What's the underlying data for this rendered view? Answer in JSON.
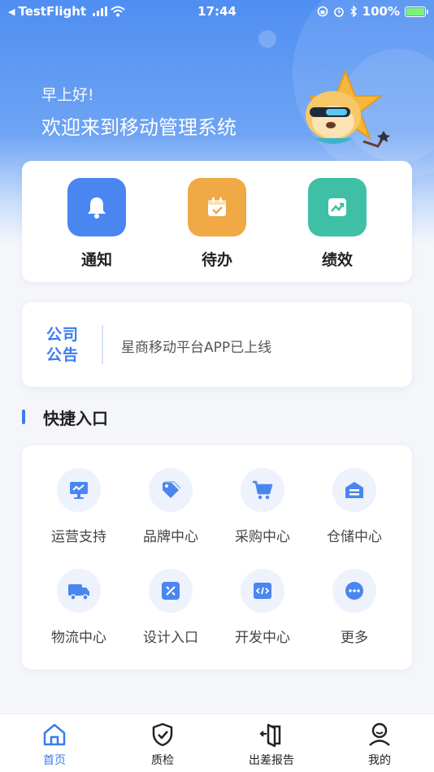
{
  "status_bar": {
    "back_app": "TestFlight",
    "time": "17:44",
    "battery": "100%",
    "battery_level": 1.0
  },
  "greeting": {
    "small": "早上好!",
    "title": "欢迎来到移动管理系统"
  },
  "quick_actions": [
    {
      "label": "通知",
      "icon": "bell-icon",
      "color": "#4a86f0"
    },
    {
      "label": "待办",
      "icon": "calendar-check-icon",
      "color": "#f0a944"
    },
    {
      "label": "绩效",
      "icon": "trend-chart-icon",
      "color": "#3fbfa5"
    }
  ],
  "notice": {
    "tag_line1": "公司",
    "tag_line2": "公告",
    "text": "星商移动平台APP已上线"
  },
  "shortcuts": {
    "title": "快捷入口",
    "items": [
      {
        "label": "运营支持",
        "icon": "monitor-chart-icon"
      },
      {
        "label": "品牌中心",
        "icon": "tag-icon"
      },
      {
        "label": "采购中心",
        "icon": "cart-icon"
      },
      {
        "label": "仓储中心",
        "icon": "warehouse-icon"
      },
      {
        "label": "物流中心",
        "icon": "truck-icon"
      },
      {
        "label": "设计入口",
        "icon": "design-tools-icon"
      },
      {
        "label": "开发中心",
        "icon": "code-icon"
      },
      {
        "label": "更多",
        "icon": "more-icon"
      }
    ]
  },
  "tabbar": {
    "items": [
      {
        "label": "首页",
        "icon": "home-icon",
        "active": true
      },
      {
        "label": "质检",
        "icon": "shield-check-icon",
        "active": false
      },
      {
        "label": "出差报告",
        "icon": "door-exit-icon",
        "active": false
      },
      {
        "label": "我的",
        "icon": "user-icon",
        "active": false
      }
    ]
  },
  "colors": {
    "accent": "#3a7bef",
    "hero_top": "#4f8ef2",
    "page_bg": "#f4f6fa"
  }
}
